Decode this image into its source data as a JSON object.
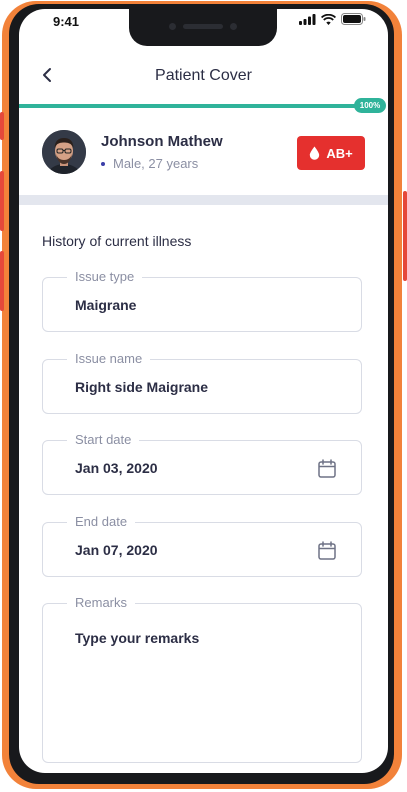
{
  "status_bar": {
    "time": "9:41"
  },
  "header": {
    "title": "Patient Cover"
  },
  "progress": {
    "value_percent": 100,
    "label": "100%"
  },
  "patient": {
    "name": "Johnson Mathew",
    "info": "Male, 27 years",
    "blood_type": "AB+"
  },
  "section": {
    "title": "History of current illness"
  },
  "fields": {
    "issue_type": {
      "label": "Issue type",
      "value": "Maigrane"
    },
    "issue_name": {
      "label": "Issue name",
      "value": "Right side Maigrane"
    },
    "start_date": {
      "label": "Start date",
      "value": "Jan 03, 2020"
    },
    "end_date": {
      "label": "End date",
      "value": "Jan 07, 2020"
    },
    "remarks": {
      "label": "Remarks",
      "placeholder": "Type your remarks"
    }
  },
  "colors": {
    "frame": "#f2823a",
    "accent": "#2fb39a",
    "blood_badge": "#e5302e",
    "text_primary": "#2c2e45",
    "text_secondary": "#8b8fa3"
  },
  "icons": {
    "back": "chevron-left-icon",
    "calendar": "calendar-icon",
    "blood": "blood-drop-icon"
  }
}
